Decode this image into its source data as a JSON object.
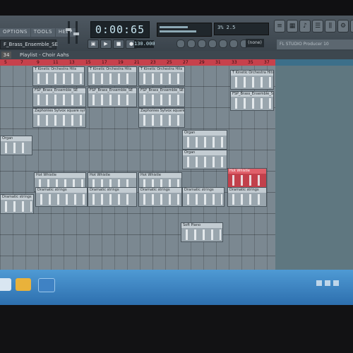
{
  "menu": [
    "OPTIONS",
    "TOOLS",
    "HELP"
  ],
  "file_field": "F_Brass_Ensemble_SE",
  "time": "0:00:65",
  "tempo": "130.000",
  "cpu": "3%  2.5",
  "snap": "(none)",
  "hint": "FL STUDIO Producer 10",
  "playlist": {
    "number": "34",
    "title": "Playlist - Choir Aahs"
  },
  "ruler_ticks": [
    "5",
    "7",
    "9",
    "11",
    "13",
    "15",
    "17",
    "19",
    "21",
    "23",
    "25",
    "27",
    "29",
    "31",
    "33",
    "35",
    "37"
  ],
  "clips": [
    {
      "name": "T Kinetic Orchestra Hits",
      "sel": false
    },
    {
      "name": "T Kinetic Orchestra Hits",
      "sel": false
    },
    {
      "name": "T Kinetic Orchestra Hits",
      "sel": false
    },
    {
      "name": "T Kinetic Orchestra Hits",
      "sel": false
    },
    {
      "name": "FSP_Brass_Ensemble_SE",
      "sel": false
    },
    {
      "name": "FSP_Brass_Ensemble_SE",
      "sel": false
    },
    {
      "name": "FSP_Brass_Ensemble_SE",
      "sel": false
    },
    {
      "name": "FSP_Brass_Ensemble_SE",
      "sel": false
    },
    {
      "name": "Zaphonies Sylvox square synth",
      "sel": false
    },
    {
      "name": "Zaphonies Sylvox square synth",
      "sel": false
    },
    {
      "name": "Organ",
      "sel": false
    },
    {
      "name": "Organ",
      "sel": false
    },
    {
      "name": "Organ",
      "sel": false
    },
    {
      "name": "Hot Whistle",
      "sel": false
    },
    {
      "name": "Hot Whistle",
      "sel": false
    },
    {
      "name": "Hot Whistle",
      "sel": false
    },
    {
      "name": "Hot Whistle",
      "sel": true
    },
    {
      "name": "Dramatic strings",
      "sel": false
    },
    {
      "name": "Dramatic strings",
      "sel": false
    },
    {
      "name": "Dramatic strings",
      "sel": false
    },
    {
      "name": "Dramatic strings",
      "sel": false
    },
    {
      "name": "Dramatic strings",
      "sel": false
    },
    {
      "name": "Dramatic strings",
      "sel": false
    },
    {
      "name": "Soft Piano",
      "sel": false
    }
  ]
}
